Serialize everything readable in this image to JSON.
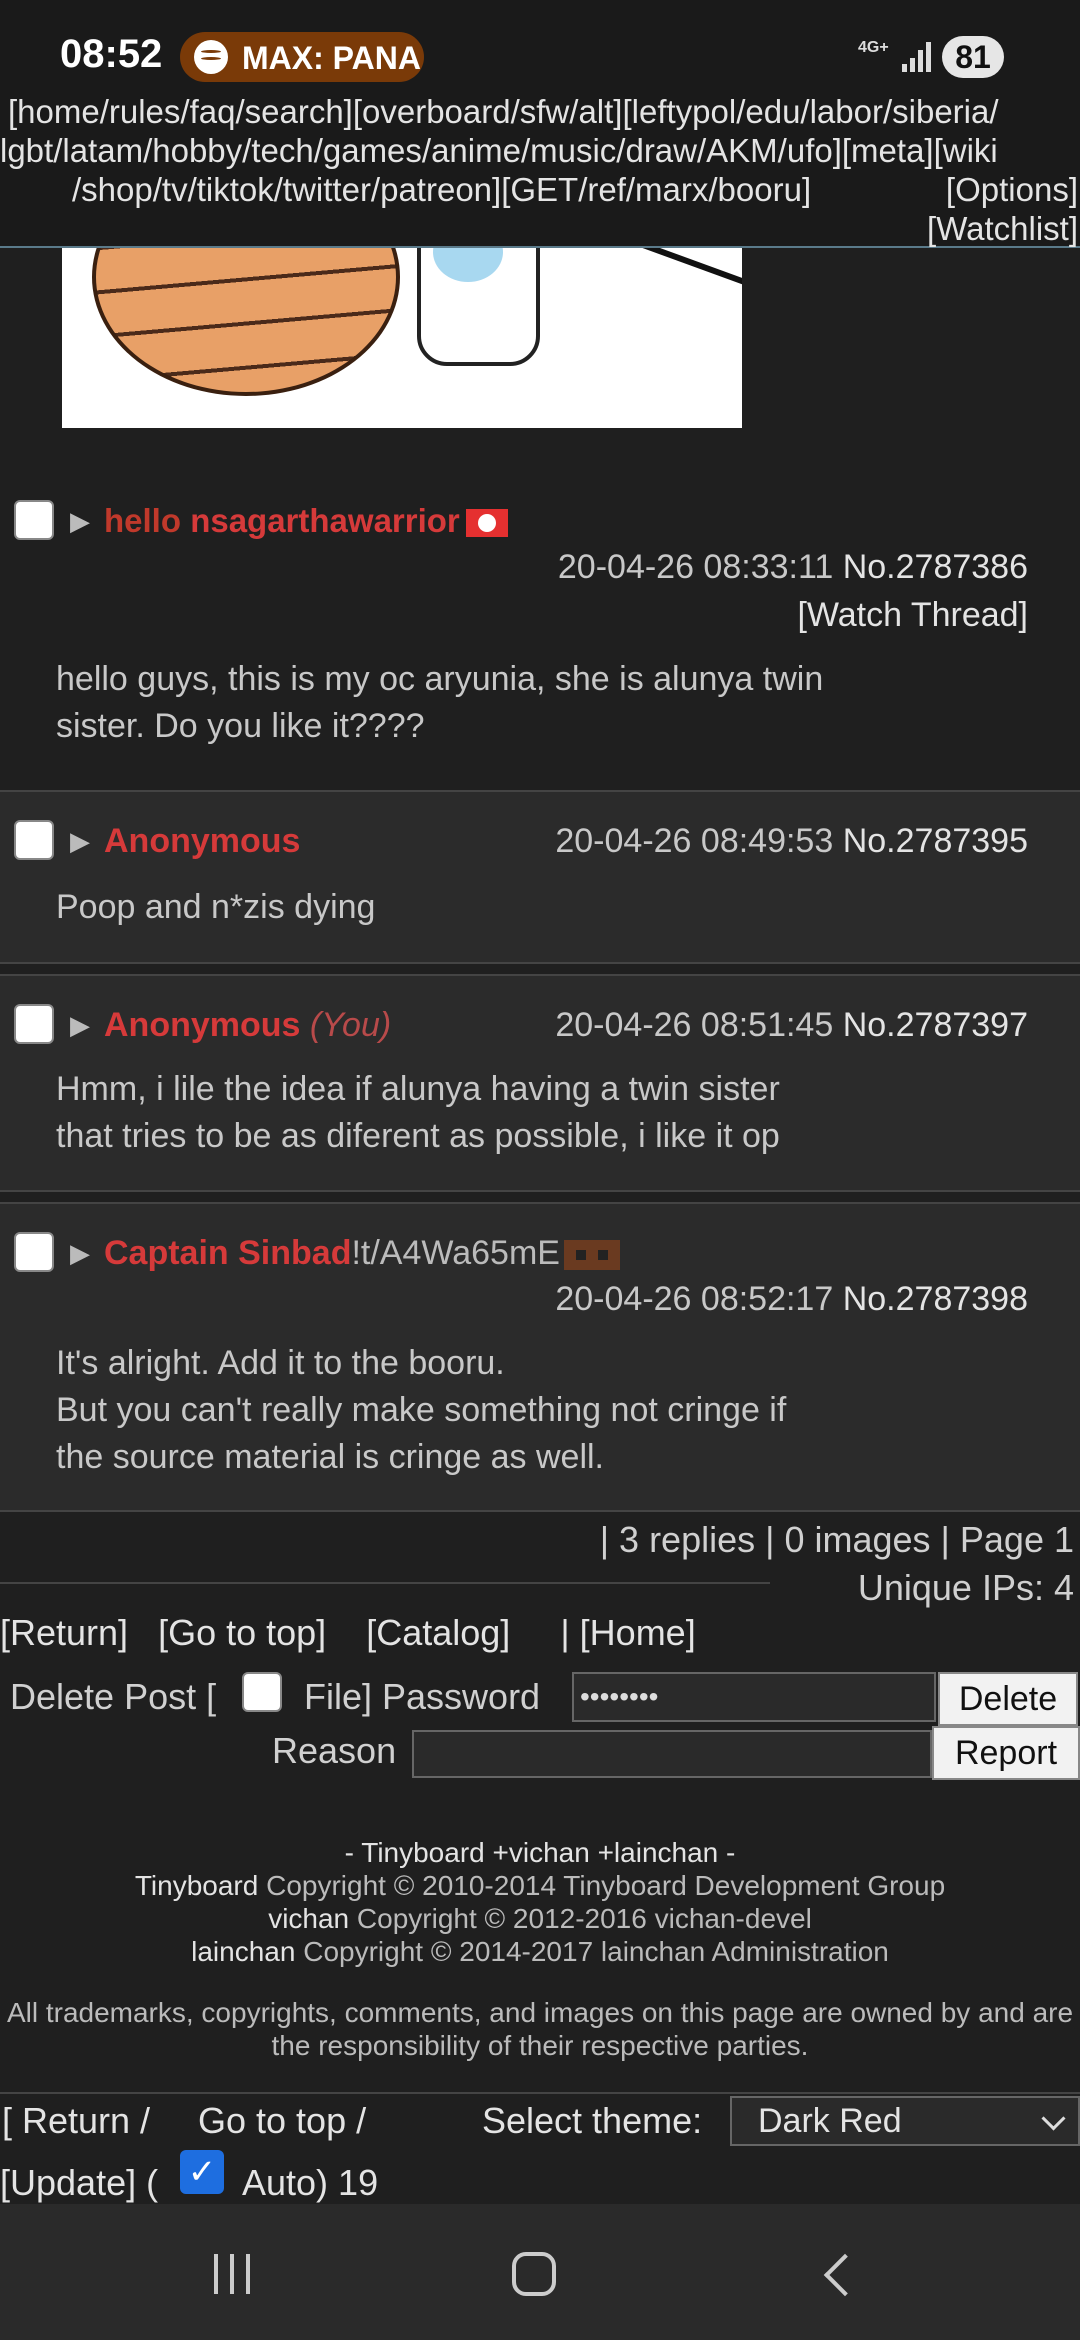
{
  "status_bar": {
    "time": "08:52",
    "media_label": "MAX: PANA",
    "network": "4G+",
    "battery": "81"
  },
  "top_nav": {
    "line1": "[home/rules/faq/search][overboard/sfw/alt][leftypol/edu/labor/siberia/",
    "line2": "lgbt/latam/hobby/tech/games/anime/music/draw/AKM/ufo][meta][wiki",
    "line3": "/shop/tv/tiktok/twitter/patreon][GET/ref/marx/booru]",
    "options": "[Options]",
    "watchlist": "[Watchlist]"
  },
  "op_post": {
    "subject": "hello",
    "name": "nsagarthawarrior",
    "date": "20-04-26 08:33:11",
    "number": "No.2787386",
    "watch_thread": "[Watch Thread]",
    "body": "hello guys, this is my oc aryunia, she is alunya twin\nsister. Do you like it????"
  },
  "replies": [
    {
      "name": "Anonymous",
      "you": "",
      "date": "20-04-26 08:49:53",
      "number": "No.2787395",
      "body": "Poop and n*zis dying"
    },
    {
      "name": "Anonymous",
      "you": "(You)",
      "date": "20-04-26 08:51:45",
      "number": "No.2787397",
      "body": "Hmm, i lile the idea if alunya having a twin sister\nthat tries to be as diferent as possible, i like it op"
    },
    {
      "name": "Captain Sinbad",
      "tripcode": "!t/A4Wa65mE",
      "date": "20-04-26 08:52:17",
      "number": "No.2787398",
      "body": "It's alright. Add it to the booru.\nBut you can't really make something not cringe if\nthe source material is cringe as well."
    }
  ],
  "thread_stats": {
    "line1": "| 3 replies | 0 images | Page 1",
    "line2": "Unique IPs: 4"
  },
  "bottom_nav": {
    "return": "[Return]",
    "top": "[Go to top]",
    "catalog": "[Catalog]",
    "home": "| [Home]"
  },
  "delete_form": {
    "delete_post": "Delete Post [",
    "file": "File] Password",
    "password_value": "••••••••",
    "delete_button": "Delete",
    "reason_label": "Reason",
    "report_button": "Report"
  },
  "footer": {
    "line1": "- Tinyboard +vichan +lainchan -",
    "tinyboard": "Tinyboard",
    "tinyboard_copy": " Copyright © 2010-2014 Tinyboard Development Group",
    "vichan": "vichan",
    "vichan_copy": " Copyright © 2012-2016 vichan-devel",
    "lainchan": "lainchan",
    "lainchan_copy": " Copyright © 2014-2017 lainchan Administration",
    "legal": "All trademarks, copyrights, comments, and images on this page are owned by and are the responsibility of their respective parties."
  },
  "bottom_bar": {
    "return": "[ Return /",
    "top": "Go to top /",
    "theme_label": "Select theme:",
    "theme_value": "Dark Red",
    "update": "[Update] (",
    "auto": "Auto) 19"
  },
  "colors": {
    "name_red": "#d63a3a",
    "background": "#1f1f1f",
    "reply_bg": "#2b2b2b",
    "checkbox_blue": "#1e6ee0"
  }
}
